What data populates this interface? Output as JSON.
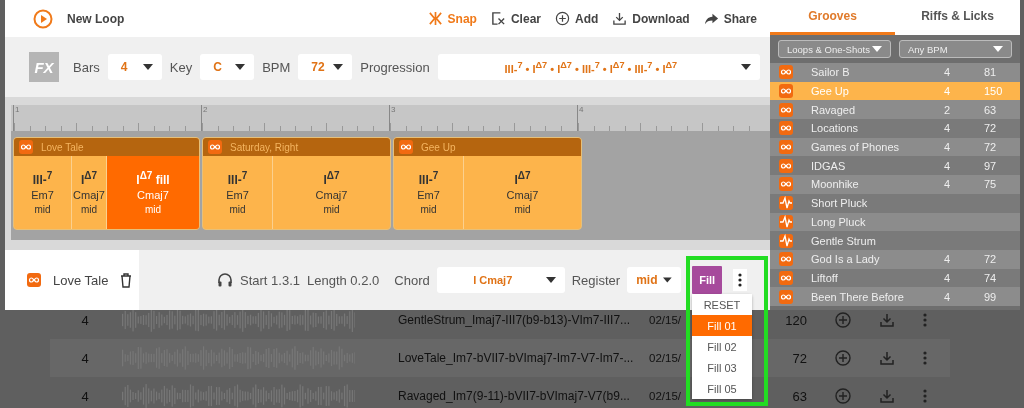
{
  "header": {
    "title": "New Loop",
    "tools": [
      {
        "kind": "snap",
        "label": "Snap",
        "active": true
      },
      {
        "kind": "clear",
        "label": "Clear",
        "active": false
      },
      {
        "kind": "add",
        "label": "Add",
        "active": false
      },
      {
        "kind": "download",
        "label": "Download",
        "active": false
      },
      {
        "kind": "share",
        "label": "Share",
        "active": false
      }
    ]
  },
  "controls": {
    "fx_label": "FX",
    "fields": [
      {
        "kind": "small",
        "label": "Bars",
        "value": "4"
      },
      {
        "kind": "small",
        "label": "Key",
        "value": "C"
      },
      {
        "kind": "small",
        "label": "BPM",
        "value": "72"
      },
      {
        "kind": "wide",
        "label": "Progression",
        "value": "III-$^{7}$ • I$^{Δ7}$ • I$^{Δ7}$ • III-$^{7}$ • I$^{Δ7}$ • III-$^{7}$ • I$^{Δ7}$"
      }
    ]
  },
  "ruler": {
    "marks": [
      "1",
      "2",
      "3",
      "4"
    ]
  },
  "clips": [
    {
      "title": "Love Tale",
      "chords": [
        {
          "numeral": "III-$^{7}$",
          "name": "Em7",
          "register": "mid",
          "selected": false
        },
        {
          "numeral": "I$^{Δ7}$",
          "name": "Cmaj7",
          "register": "mid",
          "selected": false
        },
        {
          "numeral": "I$^{Δ7}$ fill",
          "name": "Cmaj7",
          "register": "mid",
          "selected": true
        }
      ]
    },
    {
      "title": "Saturday, Right",
      "chords": [
        {
          "numeral": "III-$^{7}$",
          "name": "Em7",
          "register": "mid",
          "selected": false
        },
        {
          "numeral": "I$^{Δ7}$",
          "name": "Cmaj7",
          "register": "mid",
          "selected": false
        }
      ]
    },
    {
      "title": "Gee Up",
      "chords": [
        {
          "numeral": "III-$^{7}$",
          "name": "Em7",
          "register": "mid",
          "selected": false
        },
        {
          "numeral": "I$^{Δ7}$",
          "name": "Cmaj7",
          "register": "mid",
          "selected": false
        }
      ]
    }
  ],
  "bottom_bar": {
    "clip_name": "Love Tale",
    "start": "Start 1.3.1",
    "length": "Length 0.2.0",
    "chord_label": "Chord",
    "chord_value": "I Cmaj7",
    "register_label": "Register",
    "register_value": "mid",
    "fill_badge": "Fill"
  },
  "fill_menu": {
    "items": [
      {
        "label": "RESET",
        "selected": false
      },
      {
        "label": "Fill 01",
        "selected": true
      },
      {
        "label": "Fill 02",
        "selected": false
      },
      {
        "label": "Fill 03",
        "selected": false
      },
      {
        "label": "Fill 05",
        "selected": false
      }
    ]
  },
  "sidebar": {
    "tabs": [
      {
        "label": "Grooves",
        "selected": true
      },
      {
        "label": "Riffs & Licks",
        "selected": false
      }
    ],
    "filters": [
      "Loops & One-Shots",
      "Any BPM"
    ],
    "items": [
      {
        "kind": "loop",
        "name": "Sailor B",
        "bars": "4",
        "bpm": "81",
        "selected": false
      },
      {
        "kind": "loop",
        "name": "Gee Up",
        "bars": "4",
        "bpm": "150",
        "selected": true
      },
      {
        "kind": "loop",
        "name": "Ravaged",
        "bars": "2",
        "bpm": "63",
        "selected": false
      },
      {
        "kind": "loop",
        "name": "Locations",
        "bars": "4",
        "bpm": "72",
        "selected": false
      },
      {
        "kind": "loop",
        "name": "Games of Phones",
        "bars": "4",
        "bpm": "72",
        "selected": false
      },
      {
        "kind": "loop",
        "name": "IDGAS",
        "bars": "4",
        "bpm": "97",
        "selected": false
      },
      {
        "kind": "loop",
        "name": "Moonhike",
        "bars": "4",
        "bpm": "75",
        "selected": false
      },
      {
        "kind": "shot",
        "name": "Short Pluck",
        "selected": false
      },
      {
        "kind": "shot",
        "name": "Long Pluck",
        "selected": false
      },
      {
        "kind": "shot",
        "name": "Gentle Strum",
        "selected": false
      },
      {
        "kind": "loop",
        "name": "God Is a Lady",
        "bars": "4",
        "bpm": "72",
        "selected": false
      },
      {
        "kind": "loop",
        "name": "Liftoff",
        "bars": "4",
        "bpm": "74",
        "selected": false
      },
      {
        "kind": "loop",
        "name": "Been There Before",
        "bars": "4",
        "bpm": "99",
        "selected": false
      }
    ]
  },
  "table_rows": [
    {
      "bars": "4",
      "file": "GentleStrum_Imaj7-III7(b9-b13)-VIm7-III7...",
      "date": "02/15/",
      "bpm": "120"
    },
    {
      "bars": "4",
      "file": "LoveTale_Im7-bVII7-bVImaj7-Im7-V7-Im7-...",
      "date": "02/15/",
      "bpm": "72"
    },
    {
      "bars": "4",
      "file": "Ravaged_Im7(9-11)-bVII7-bVImaj7-V7(b9...",
      "date": "02/15/",
      "bpm": "63"
    }
  ]
}
